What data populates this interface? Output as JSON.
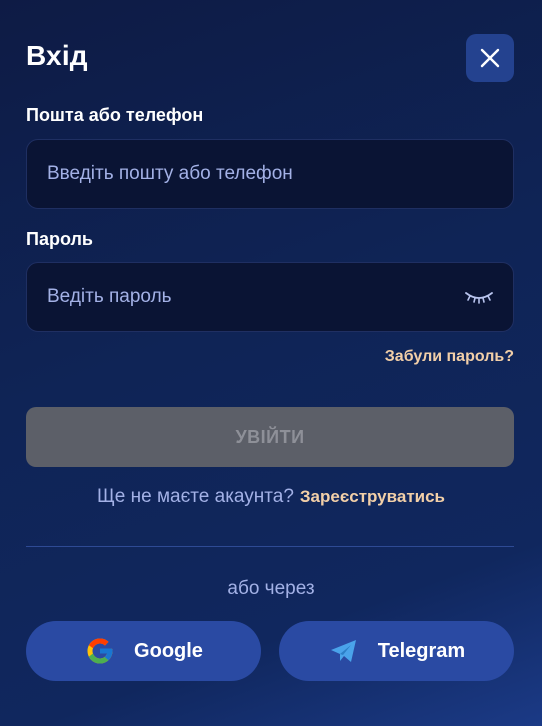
{
  "modal": {
    "title": "Вхід",
    "close_icon": "close-icon"
  },
  "login": {
    "label": "Пошта або телефон",
    "placeholder": "Введіть пошту або телефон",
    "value": ""
  },
  "password": {
    "label": "Пароль",
    "placeholder": "Ведіть пароль",
    "value": "",
    "toggle_icon": "eye-closed-icon"
  },
  "forgot_label": "Забули пароль?",
  "submit_label": "УВІЙТИ",
  "register": {
    "prompt": "Ще не маєте акаунта?",
    "link": "Зареєструватись"
  },
  "or_label": "або через",
  "social": {
    "google": {
      "label": "Google",
      "icon": "google-icon"
    },
    "telegram": {
      "label": "Telegram",
      "icon": "telegram-icon"
    }
  },
  "colors": {
    "accent_link": "#f2cfa8",
    "button_disabled": "#5c5f68",
    "social_button": "#2a4aa3"
  }
}
